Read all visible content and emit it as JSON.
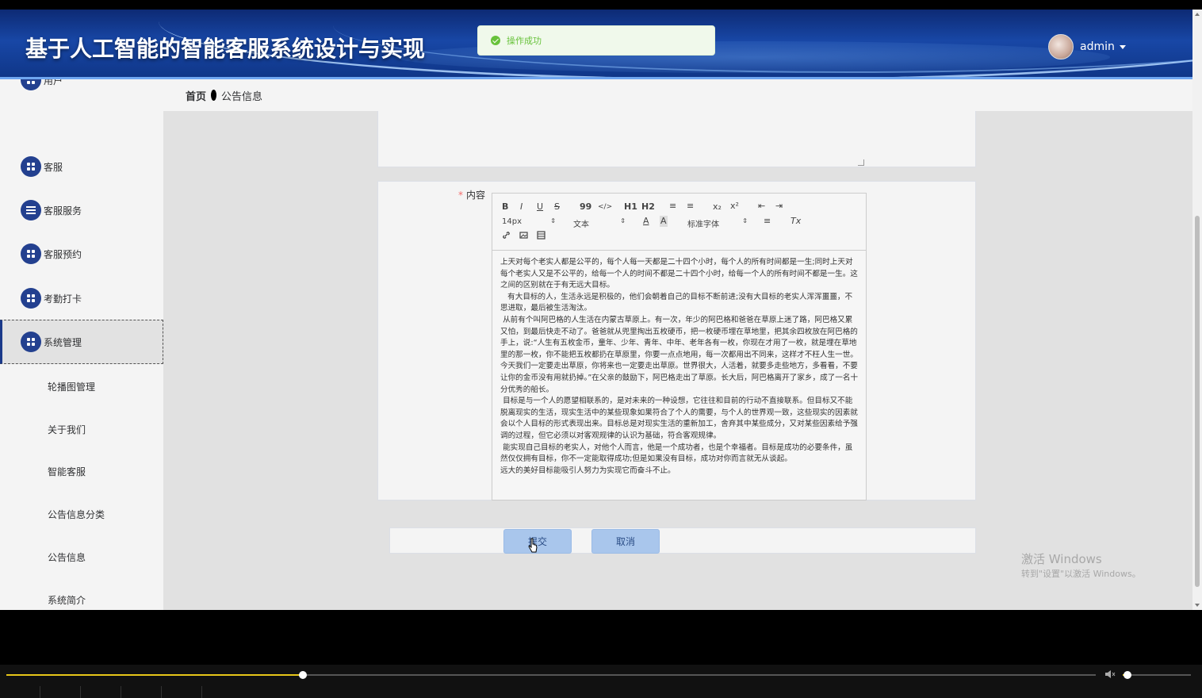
{
  "header": {
    "title": "基于人工智能的智能客服系统设计与实现",
    "user": "admin"
  },
  "toast": {
    "text": "操作成功"
  },
  "breadcrumb": {
    "home": "首页",
    "current": "公告信息"
  },
  "sidebar": {
    "items": [
      {
        "label": "用户",
        "icon": "grid-icon"
      },
      {
        "label": "客服",
        "icon": "grid-icon"
      },
      {
        "label": "客服服务",
        "icon": "sliders-icon"
      },
      {
        "label": "客服预约",
        "icon": "grid-icon"
      },
      {
        "label": "考勤打卡",
        "icon": "grid-icon"
      },
      {
        "label": "系统管理",
        "icon": "grid-icon",
        "active": true
      }
    ],
    "sub_items": [
      "轮播图管理",
      "关于我们",
      "智能客服",
      "公告信息分类",
      "公告信息",
      "系统简介"
    ]
  },
  "form": {
    "content_label": "内容",
    "required_mark": "*",
    "toolbar": {
      "bold": "B",
      "italic": "I",
      "underline": "U",
      "strike": "S",
      "quote": "99",
      "code": "</>",
      "h1": "H1",
      "h2": "H2",
      "ordered": "≡",
      "bullet": "≡",
      "sub": "x₂",
      "sup": "x²",
      "outdent": "⇤",
      "indent": "⇥",
      "size": "14px",
      "heading": "文本",
      "font_color": "A",
      "bg_color": "A",
      "font": "标准字体",
      "align": "≡",
      "clean": "Tx"
    },
    "content_paragraphs": [
      "上天对每个老实人都是公平的，每个人每一天都是二十四个小时，每个人的所有时间都是一生;同时上天对每个老实人又是不公平的，给每一个人的时间不都是二十四个小时，给每一个人的所有时间不都是一生。这之间的区别就在于有无远大目标。",
      "   有大目标的人，生活永远是积极的，他们会朝着自己的目标不断前进;没有大目标的老实人浑浑噩噩，不思进取，最后被生活淘汰。",
      " 从前有个叫阿巴格的人生活在内蒙古草原上。有一次，年少的阿巴格和爸爸在草原上迷了路，阿巴格又累又怕，到最后快走不动了。爸爸就从兜里掏出五枚硬币，把一枚硬币埋在草地里，把其余四枚放在阿巴格的手上，说:“人生有五枚金币，童年、少年、青年、中年、老年各有一枚，你现在才用了一枚，就是埋在草地里的那一枚，你不能把五枚都扔在草原里，你要一点点地用，每一次都用出不同来，这样才不枉人生一世。今天我们一定要走出草原，你将来也一定要走出草原。世界很大，人活着，就要多走些地方，多看看，不要让你的金币没有用就扔掉。”在父亲的鼓励下，阿巴格走出了草原。长大后，阿巴格离开了家乡，成了一名十分优秀的船长。",
      " 目标是与一个人的愿望相联系的，是对未来的一种设想，它往往和目前的行动不直接联系。但目标又不能脱离现实的生活，现实生活中的某些现象如果符合了个人的需要，与个人的世界观一致，这些现实的因素就会以个人目标的形式表现出来。目标总是对现实生活的重新加工，舍弃其中某些成分，又对某些因素给予强调的过程，但它必须以对客观规律的认识为基础，符合客观规律。",
      " 能实现自己目标的老实人，对他个人而言，他是一个成功者，也是个幸福者。目标是成功的必要条件，虽然仅仅拥有目标，你不一定能取得成功;但是如果没有目标，成功对你而言就无从谈起。",
      "远大的美好目标能吸引人努力为实现它而奋斗不止。"
    ],
    "submit": "提交",
    "cancel": "取消"
  },
  "watermark": {
    "line1": "激活 Windows",
    "line2": "转到\"设置\"以激活 Windows。"
  },
  "player": {
    "progress": 0.272,
    "volume": 0.07
  },
  "colors": {
    "header": "#1847a6",
    "accent": "#23408f",
    "button": "#a9c6ec",
    "success": "#67c23a",
    "progress": "#e6c619"
  }
}
